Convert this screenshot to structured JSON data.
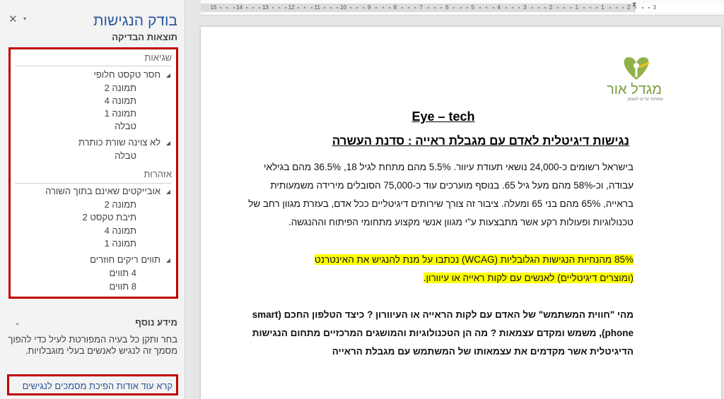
{
  "pane": {
    "title": "בודק הנגישות",
    "close_symbol": "✕",
    "dropdown_symbol": "▾",
    "results_heading": "תוצאות הבדיקה",
    "errors_heading": "שגיאות",
    "warnings_heading": "אזהרות",
    "groups": {
      "g1": "חסר טקסט חלופי",
      "g1c1": "תמונה 2",
      "g1c2": "תמונה 4",
      "g1c3": "תמונה 1",
      "g1c4": "טבלה",
      "g2": "לא צוינה שורת כותרת",
      "g2c1": "טבלה",
      "g3": "אובייקטים שאינם בתוך השורה",
      "g3c1": "תמונה 2",
      "g3c2": "תיבת טקסט 2",
      "g3c3": "תמונה 4",
      "g3c4": "תמונה 1",
      "g4": "תווים ריקים חוזרים",
      "g4c1": "4 תווים",
      "g4c2": "8 תווים"
    },
    "info_heading": "מידע נוסף",
    "info_chevron": "⌄",
    "info_text": "בחר ותקן כל בעיה המפורטת לעיל כדי להפוך מסמך זה לנגיש לאנשים בעלי מוגבלויות.",
    "read_more_link": "קרא עוד אודות הפיכת מסמכים לנגישים"
  },
  "ruler": {
    "labels": [
      "15",
      "14",
      "13",
      "12",
      "11",
      "10",
      "9",
      "8",
      "7",
      "6",
      "5",
      "4",
      "3",
      "2",
      "1",
      "1",
      "2",
      "3"
    ]
  },
  "document": {
    "logo_text": "מגדל אור",
    "logo_subtitle": "עמותת יעדים לעצמן",
    "title": "Eye – tech",
    "subtitle": "נגישות דיגיטלית לאדם עם מגבלת ראייה : סדנת העשרה",
    "paragraph1": "בישראל רשומים כ-24,000 נושאי תעודת עיוור. 5.5% מהם מתחת לגיל 18, 36.5% מהם בגילאי עבודה, וכ-58% מהם מעל גיל 65. בנוסף מוערכים עוד כ-75,000 הסובלים מירידה משמעותית בראייה, 65% מהם בני 65 ומעלה. ציבור זה צורך שירותים דיגיטליים ככל אדם, בעזרת מגוון רחב של טכנולוגיות ופעולות רקע אשר מתבצעות ע\"י מגוון אנשי מקצוע מתחומי הפיתוח וההנגשה.",
    "paragraph2_line1": "85% מהנחיות הנגישות הגלובליות (WCAG) נכתבו על מנת להנגיש את האינטרנט",
    "paragraph2_line2": "(ומוצרים דיגיטליים) לאנשים עם לקות ראייה או עיוורון.",
    "paragraph3": "מהי \"חווית המשתמש\" של האדם עם לקות הראייה או העיוורון ? כיצד הטלפון החכם (smart phone), משמש ומקדם עצמאות ? מה הן הטכנולוגיות והמושגים המרכזיים מתחום הנגישות הדיגיטלית אשר מקדמים את עצמאותו של המשתמש עם מגבלת הראייה"
  },
  "colors": {
    "accent": "#2b579a",
    "highlight": "#ffff00",
    "error_border": "#c00000",
    "logo_green": "#7a9c3c"
  }
}
